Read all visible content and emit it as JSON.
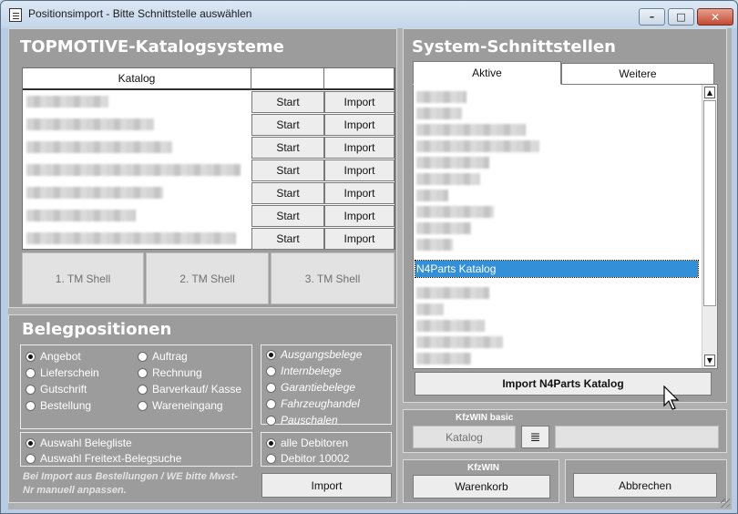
{
  "window": {
    "title": "Positionsimport - Bitte Schnittstelle auswählen"
  },
  "catalog": {
    "title": "TOPMOTIVE-Katalogsysteme",
    "col_header": "Katalog",
    "rows": [
      {
        "start": "Start",
        "import": "Import"
      },
      {
        "start": "Start",
        "import": "Import"
      },
      {
        "start": "Start",
        "import": "Import"
      },
      {
        "start": "Start",
        "import": "Import"
      },
      {
        "start": "Start",
        "import": "Import"
      },
      {
        "start": "Start",
        "import": "Import"
      },
      {
        "start": "Start",
        "import": "Import"
      }
    ],
    "shells": [
      "1. TM Shell",
      "2. TM Shell",
      "3. TM Shell"
    ]
  },
  "beleg": {
    "title": "Belegpositionen",
    "types": [
      "Angebot",
      "Lieferschein",
      "Gutschrift",
      "Bestellung",
      "Auftrag",
      "Rechnung",
      "Barverkauf/ Kasse",
      "Wareneingang"
    ],
    "selected_type": "Angebot",
    "directions": [
      "Ausgangsbelege",
      "Internbelege",
      "Garantiebelege",
      "Fahrzeughandel",
      "Pauschalen"
    ],
    "selected_direction": "Ausgangsbelege",
    "selection": [
      "Auswahl Belegliste",
      "Auswahl Freitext-Belegsuche"
    ],
    "selected_selection": "Auswahl Belegliste",
    "debitors": [
      "alle Debitoren",
      "Debitor 10002"
    ],
    "selected_debitor": "alle Debitoren",
    "note": "Bei Import aus Bestellungen / WE bitte Mwst-Nr manuell anpassen.",
    "import_label": "Import"
  },
  "system": {
    "title": "System-Schnittstellen",
    "tabs": [
      "Aktive",
      "Weitere"
    ],
    "active_tab": "Aktive",
    "selected_item": "N4Parts Katalog",
    "import_button": "Import N4Parts Katalog"
  },
  "kfzwin_basic": {
    "label": "KfzWIN basic",
    "katalog": "Katalog"
  },
  "kfzwin": {
    "label": "KfzWIN",
    "warenkorb": "Warenkorb"
  },
  "cancel": "Abbrechen"
}
